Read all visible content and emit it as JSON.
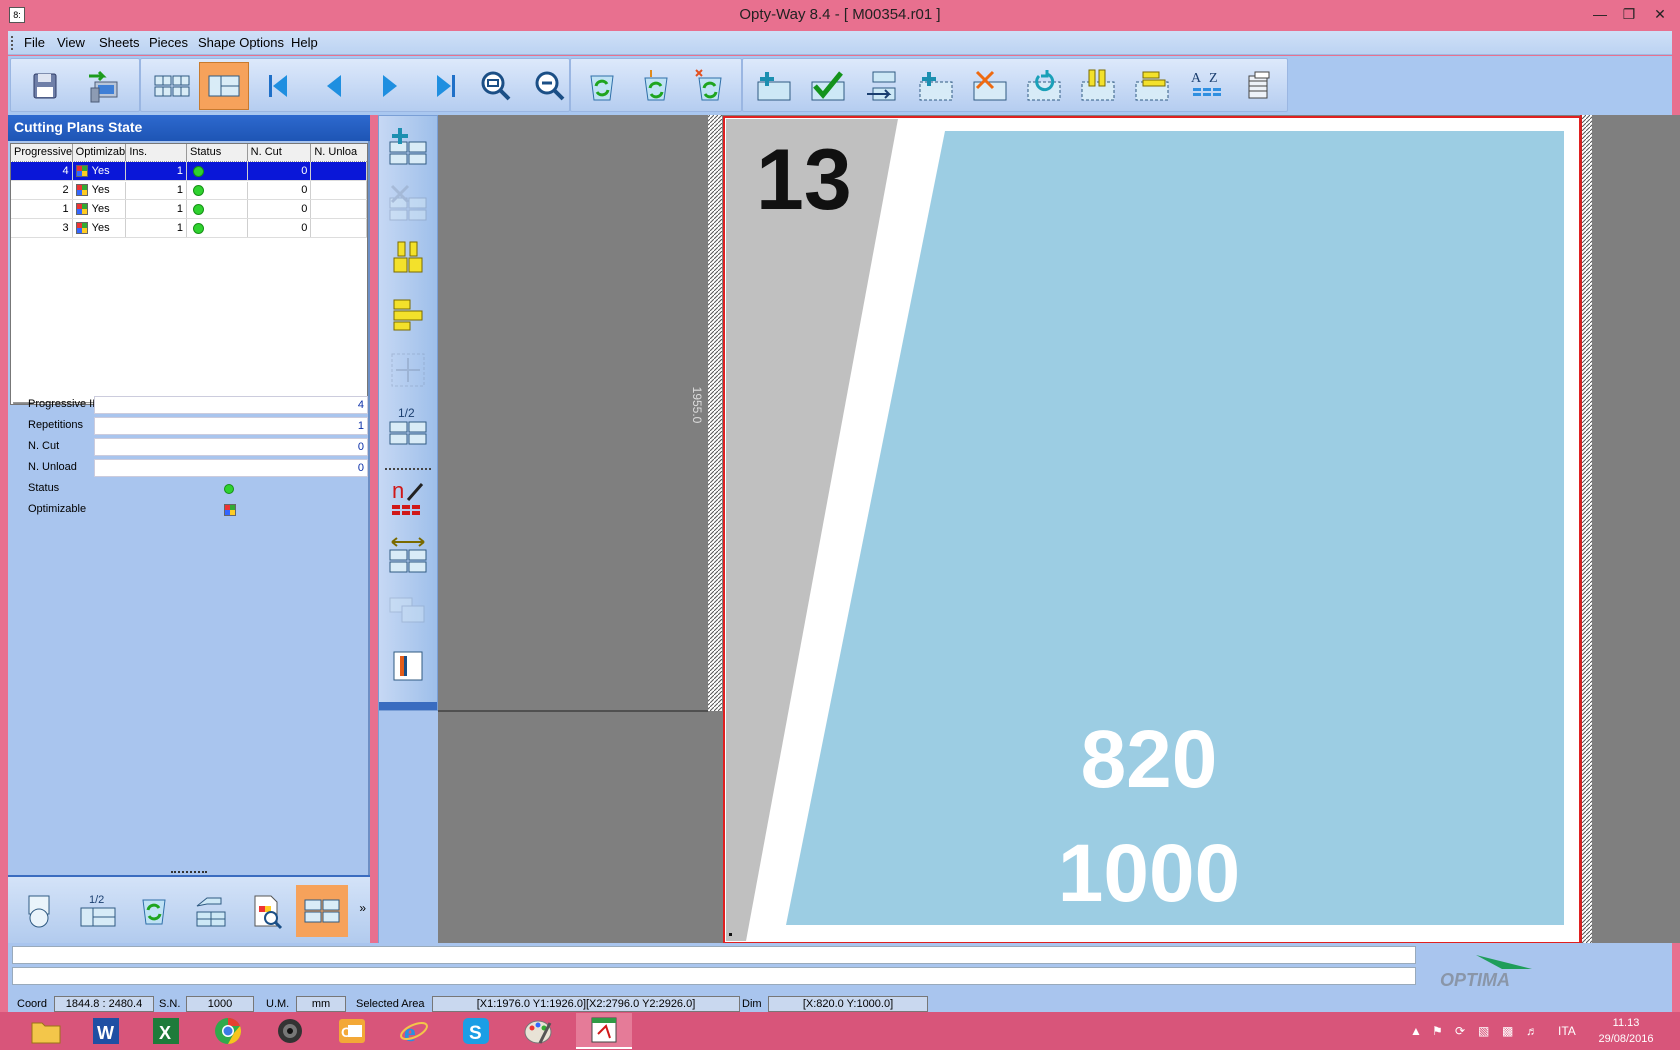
{
  "window": {
    "title": "Opty-Way 8.4  - [ M00354.r01 ]",
    "app_icon_text": "8:"
  },
  "menu": [
    "File",
    "View",
    "Sheets",
    "Pieces",
    "Shape Options",
    "Help"
  ],
  "toolbar": {
    "groups": [
      [
        "save-icon",
        "transfer-to-computer-icon"
      ],
      [
        "multi-sheet-view-icon",
        "single-sheet-view-icon",
        "first-icon",
        "previous-icon",
        "next-icon",
        "last-icon",
        "zoom-in-icon",
        "zoom-out-icon"
      ],
      [
        "recycle-icon",
        "recycle-add-icon",
        "recycle-remove-icon"
      ],
      [
        "add-piece-icon",
        "confirm-icon",
        "move-piece-icon",
        "add-dashed-piece-icon",
        "delete-piece-icon",
        "rotate-piece-icon",
        "align-vertical-icon",
        "align-horizontal-icon",
        "sort-az-icon",
        "database-icon"
      ]
    ],
    "active": "single-sheet-view-icon"
  },
  "panel": {
    "title": "Cutting Plans State",
    "columns": [
      "Progressive",
      "Optimizable",
      "Ins.",
      "Status",
      "N. Cut",
      "N. Unloa"
    ],
    "rows": [
      {
        "progressive": "4",
        "optimizable": "Yes",
        "ins": "1",
        "status": "ok",
        "ncut": "0",
        "selected": true
      },
      {
        "progressive": "2",
        "optimizable": "Yes",
        "ins": "1",
        "status": "ok",
        "ncut": "0",
        "selected": false
      },
      {
        "progressive": "1",
        "optimizable": "Yes",
        "ins": "1",
        "status": "ok",
        "ncut": "0",
        "selected": false
      },
      {
        "progressive": "3",
        "optimizable": "Yes",
        "ins": "1",
        "status": "ok",
        "ncut": "0",
        "selected": false
      }
    ],
    "properties": {
      "progressive_label": "Progressive II",
      "progressive_value": "4",
      "repetitions_label": "Repetitions",
      "repetitions_value": "1",
      "ncut_label": "N. Cut",
      "ncut_value": "0",
      "nunload_label": "N. Unload",
      "nunload_value": "0",
      "status_label": "Status",
      "optimizable_label": "Optimizable"
    },
    "bottom_buttons": [
      "shapes-icon",
      "half-sheet-icon",
      "recycle-icon",
      "move-pieces-icon",
      "piece-preview-icon",
      "multi-sheet-view-icon"
    ],
    "bottom_half_label": "1/2",
    "more": "»"
  },
  "vtoolbar": {
    "buttons": [
      "add-sheet-icon",
      "delete-sheet-icon",
      "align-vertical-icon",
      "align-horizontal-icon",
      "move-icon",
      "half-sheet-icon",
      "rename-icon",
      "stretch-icon",
      "disabled-sheet-icon",
      "trim-icon"
    ],
    "half_label": "1/2",
    "rename_label": "n"
  },
  "canvas": {
    "sheet_height_label": "1955.0",
    "sheet_number": "13",
    "piece_width": "820",
    "piece_height": "1000",
    "colors": {
      "background": "#7f7f7f",
      "sheet": "#ffffff",
      "waste": "#c0c0c0",
      "piece": "#9ccde3",
      "border": "#e02020"
    }
  },
  "status": {
    "coord_label": "Coord",
    "coord_value": "1844.8 : 2480.4",
    "sn_label": "S.N.",
    "sn_value": "1000",
    "um_label": "U.M.",
    "um_value": "mm",
    "selected_area_label": "Selected Area",
    "selected_area_value": "[X1:1976.0 Y1:1926.0][X2:2796.0 Y2:2926.0]",
    "dim_label": "Dim",
    "dim_value": "[X:820.0 Y:1000.0]"
  },
  "logo": {
    "text": "OPTIMA"
  },
  "taskbar": {
    "apps": [
      "file-explorer-icon",
      "word-icon",
      "excel-icon",
      "chrome-icon",
      "camera-icon",
      "outlook-icon",
      "internet-explorer-icon",
      "skype-icon",
      "paint-icon",
      "optyway-icon"
    ],
    "active": "optyway-icon",
    "tray_arrow": "▲",
    "language": "ITA",
    "time": "11.13",
    "date": "29/08/2016"
  }
}
